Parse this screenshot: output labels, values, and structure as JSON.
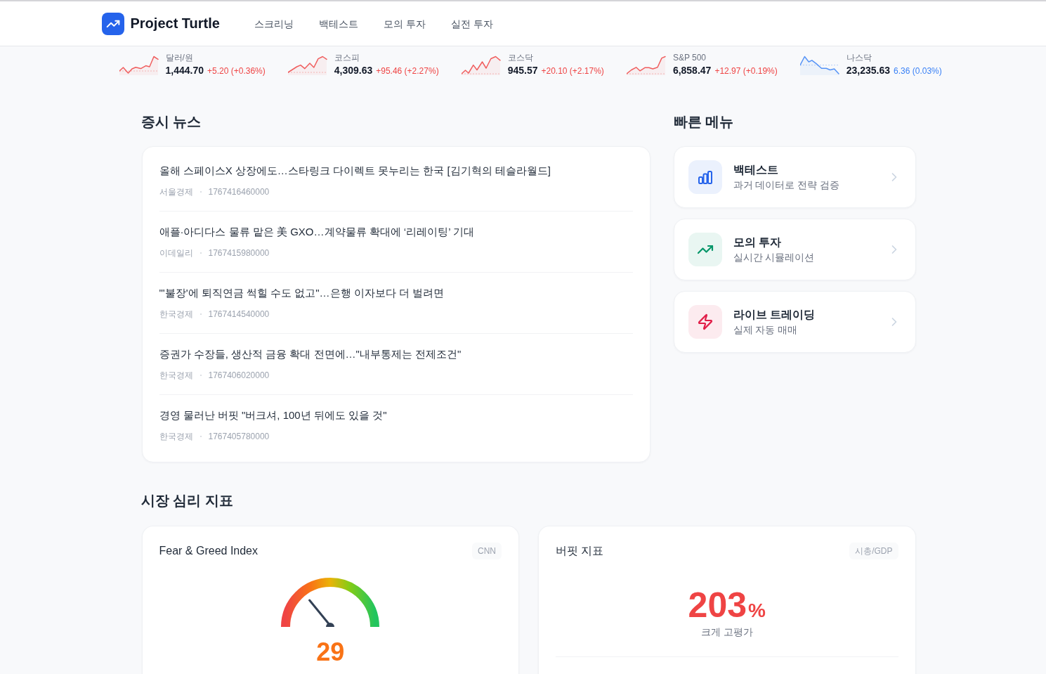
{
  "header": {
    "logo_text": "Project Turtle",
    "nav": [
      {
        "label": "스크리닝"
      },
      {
        "label": "백테스트"
      },
      {
        "label": "모의 투자"
      },
      {
        "label": "실전 투자"
      }
    ]
  },
  "tickers": [
    {
      "label": "달러/원",
      "value": "1,444.70",
      "change": "+5.20 (+0.36%)",
      "color": "#ef4444"
    },
    {
      "label": "코스피",
      "value": "4,309.63",
      "change": "+95.46 (+2.27%)",
      "color": "#ef4444"
    },
    {
      "label": "코스닥",
      "value": "945.57",
      "change": "+20.10 (+2.17%)",
      "color": "#ef4444"
    },
    {
      "label": "S&P 500",
      "value": "6,858.47",
      "change": "+12.97 (+0.19%)",
      "color": "#ef4444"
    },
    {
      "label": "나스닥",
      "value": "23,235.63",
      "change": "6.36 (0.03%)",
      "color": "#3b82f6"
    }
  ],
  "news": {
    "title": "증시 뉴스",
    "items": [
      {
        "headline": "올해 스페이스X 상장에도…스타링크 다이렉트 못누리는 한국 [김기혁의 테슬라월드]",
        "source": "서울경제",
        "time": "1767416460000"
      },
      {
        "headline": "애플·아디다스 물류 맡은 美 GXO…계약물류 확대에 ‘리레이팅’ 기대",
        "source": "이데일리",
        "time": "1767415980000"
      },
      {
        "headline": "\"'불장'에 퇴직연금 썩힐 수도 없고\"…은행 이자보다 더 벌려면",
        "source": "한국경제",
        "time": "1767414540000"
      },
      {
        "headline": "증권가 수장들, 생산적 금융 확대 전면에…\"내부통제는 전제조건\"",
        "source": "한국경제",
        "time": "1767406020000"
      },
      {
        "headline": "경영 물러난 버핏 \"버크셔, 100년 뒤에도 있을 것\"",
        "source": "한국경제",
        "time": "1767405780000"
      }
    ]
  },
  "quick_menu": {
    "title": "빠른 메뉴",
    "items": [
      {
        "kind": "chart",
        "title": "백테스트",
        "description": "과거 데이터로 전략 검증",
        "color": "#2563eb"
      },
      {
        "kind": "trend",
        "title": "모의 투자",
        "description": "실시간 시뮬레이션",
        "color": "#059669"
      },
      {
        "kind": "bolt",
        "title": "라이브 트레이딩",
        "description": "실제 자동 매매",
        "color": "#e11d48"
      }
    ]
  },
  "sentiment": {
    "title": "시장 심리 지표",
    "fear_greed": {
      "title": "Fear & Greed Index",
      "badge": "CNN",
      "value": "29"
    },
    "buffett": {
      "title": "버핏 지표",
      "badge": "시총/GDP",
      "value": "203",
      "unit": "%",
      "verdict": "크게 고평가"
    }
  }
}
